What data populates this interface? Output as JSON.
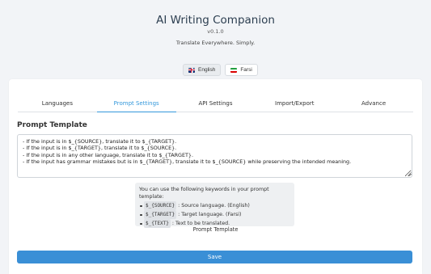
{
  "header": {
    "title": "AI Writing Companion",
    "version": "v0.1.0",
    "tagline": "Translate Everywhere. Simply."
  },
  "language_switch": [
    {
      "label": "English",
      "flag": "uk-flag-icon",
      "active": true
    },
    {
      "label": "Farsi",
      "flag": "iran-flag-icon",
      "active": false
    }
  ],
  "tabs": [
    {
      "label": "Languages",
      "active": false
    },
    {
      "label": "Prompt Settings",
      "active": true
    },
    {
      "label": "API Settings",
      "active": false
    },
    {
      "label": "Import/Export",
      "active": false
    },
    {
      "label": "Advance",
      "active": false
    }
  ],
  "prompt": {
    "section_title": "Prompt Template",
    "value": "- If the input is in $_{SOURCE}, translate it to $_{TARGET}.\n- If the input is in $_{TARGET}, translate it to $_{SOURCE}.\n- If the input is in any other language, translate it to $_{TARGET}.\n- If the input has grammar mistakes but is in $_{TARGET}, translate it to $_{SOURCE} while preserving the intended meaning."
  },
  "help": {
    "intro": "You can use the following keywords in your prompt template:",
    "keywords": [
      {
        "keyword": "$_{SOURCE}",
        "description": ": Source language. (English)"
      },
      {
        "keyword": "$_{TARGET}",
        "description": ": Target language. (Farsi)"
      },
      {
        "keyword": "$_{TEXT}",
        "description": ": Text to be translated."
      }
    ]
  },
  "caption": "Prompt Template",
  "save_label": "Save",
  "colors": {
    "accent": "#3498db",
    "save_button": "#3a8fd6",
    "background": "#f2f4f7"
  }
}
